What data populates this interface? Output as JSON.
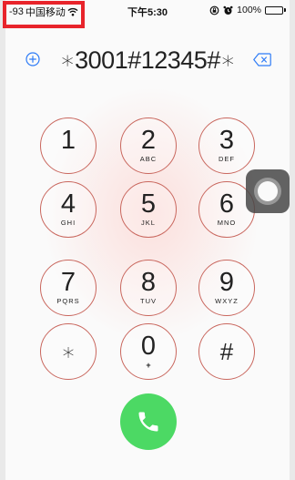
{
  "status_bar": {
    "signal": "-93",
    "carrier": "中国移动",
    "time": "下午5:30",
    "battery_percent": "100%",
    "battery_level": 1.0
  },
  "dialer": {
    "number": "∗3001#12345#∗",
    "keys": [
      {
        "digit": "1",
        "letters": ""
      },
      {
        "digit": "2",
        "letters": "ABC"
      },
      {
        "digit": "3",
        "letters": "DEF"
      },
      {
        "digit": "4",
        "letters": "GHI"
      },
      {
        "digit": "5",
        "letters": "JKL"
      },
      {
        "digit": "6",
        "letters": "MNO"
      },
      {
        "digit": "7",
        "letters": "PQRS"
      },
      {
        "digit": "8",
        "letters": "TUV"
      },
      {
        "digit": "9",
        "letters": "WXYZ"
      },
      {
        "digit": "∗",
        "letters": ""
      },
      {
        "digit": "0",
        "letters": "+"
      },
      {
        "digit": "#",
        "letters": ""
      }
    ]
  },
  "colors": {
    "key_border": "#c9675e",
    "call_button": "#4cd964",
    "accent_blue": "#2f7cf6",
    "highlight_box": "#e8242b"
  },
  "icons": {
    "add_contact": "plus-circle-icon",
    "delete": "backspace-icon",
    "call": "phone-icon",
    "wifi": "wifi-icon",
    "rotation_lock": "rotation-lock-icon",
    "alarm": "alarm-icon",
    "battery": "battery-icon",
    "assistive_touch": "assistive-touch-icon"
  }
}
